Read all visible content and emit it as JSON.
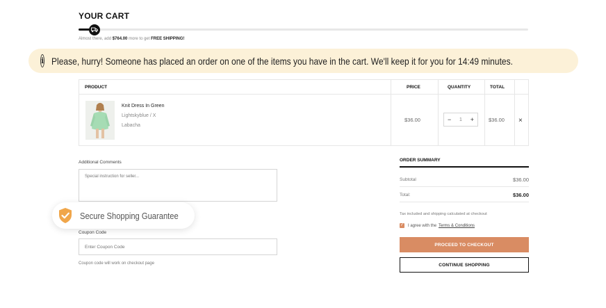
{
  "cart": {
    "title": "YOUR CART",
    "shipping_progress": 0.04,
    "shipping_msg_prefix": "Almost there, add ",
    "shipping_amount": "$764.00",
    "shipping_msg_middle": " more to get ",
    "shipping_msg_free": "FREE SHIPPING!",
    "truck_icon": "truck-icon"
  },
  "hurry_banner": {
    "icon": "info-icon",
    "icon_glyph": "i",
    "text": "Please, hurry! Someone has placed an order on one of the items you have in the cart. We'll keep it for you for 14:49 minutes."
  },
  "table": {
    "headers": {
      "product": "PRODUCT",
      "price": "PRICE",
      "quantity": "QUANTITY",
      "total": "TOTAL"
    },
    "item": {
      "name": "Knit Dress In Green",
      "variant": "Lightskyblue / X",
      "vendor": "Labacha",
      "price": "$36.00",
      "quantity": "1",
      "minus": "−",
      "plus": "+",
      "total": "$36.00",
      "remove": "×"
    }
  },
  "comments": {
    "label": "Additional Comments",
    "placeholder": "Special instruction for seller..."
  },
  "secure": {
    "icon": "shield-check-icon",
    "text": "Secure Shopping Guarantee"
  },
  "coupon": {
    "label": "Coupon Code",
    "placeholder": "Enter Coupon Code",
    "note": "Coupon code will work on checkout page"
  },
  "summary": {
    "title": "ORDER SUMMARY",
    "subtotal_label": "Subtotal",
    "subtotal_value": "$36.00",
    "total_label": "Total:",
    "total_value": "$36.00",
    "tax_note": "Tax included and shipping calculated at checkout",
    "agree_text": "I agree with the",
    "terms_text": "Terms & Conditions",
    "checkout_label": "PROCEED TO CHECKOUT",
    "continue_label": "CONTINUE SHOPPING"
  },
  "colors": {
    "accent": "#d98c63",
    "banner_bg": "#fcf1d8",
    "shield": "#f0a64a"
  }
}
